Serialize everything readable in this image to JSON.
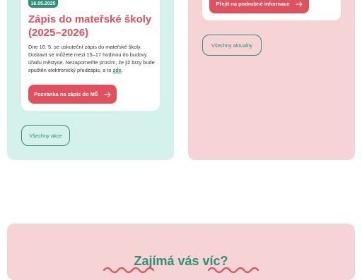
{
  "left": {
    "badge_date": "16.05.2025",
    "title": "Zápis do mateřské školy (2025–2026)",
    "text_before_link": "Dne 16. 5. se uskuteční zápis do mateřské školy. Dostavit se můžete mezi 15–17 hodinou do budovy úřadu městyse. Nezapomeňte prosím, že již brzy bude spuštěn elektronický předzápis, a to ",
    "link_text": "zde",
    "text_after_link": ".",
    "invite_button": "Pozvánka na zápis do MŠ",
    "all_button": "Všechny akce"
  },
  "right": {
    "detail_button": "Přejít na podrobné informace",
    "all_button": "Všechny aktuality"
  },
  "banner": {
    "title": "Zajímá vás víc?"
  },
  "colors": {
    "accent_red": "#e0505e",
    "accent_green": "#2f8f77",
    "mint_panel": "#d4f1ec",
    "pink_panel": "#f6d3d4"
  },
  "icons": [
    "arrow-right-icon",
    "wave-decoration-icon"
  ]
}
